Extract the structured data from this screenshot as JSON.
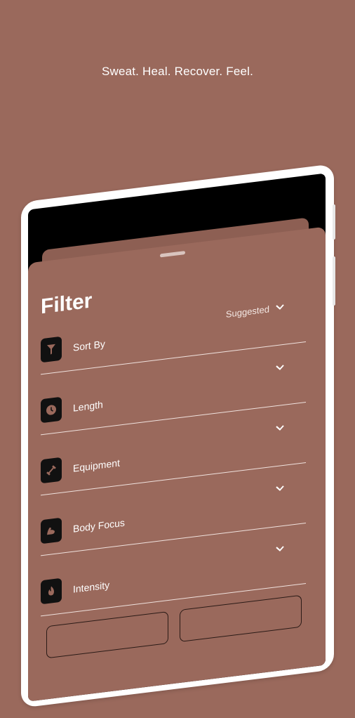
{
  "tagline": "Sweat. Heal. Recover. Feel.",
  "sheet": {
    "title": "Filter",
    "rows": [
      {
        "label": "Sort By",
        "value": "Suggested",
        "icon": "funnel-icon"
      },
      {
        "label": "Length",
        "value": "",
        "icon": "clock-icon"
      },
      {
        "label": "Equipment",
        "value": "",
        "icon": "dumbbell-icon"
      },
      {
        "label": "Body Focus",
        "value": "",
        "icon": "flexed-arm-icon"
      },
      {
        "label": "Intensity",
        "value": "",
        "icon": "flame-icon"
      }
    ]
  },
  "colors": {
    "background": "#9a695c",
    "icon_tile": "#111111",
    "device_frame": "#ffffff"
  }
}
